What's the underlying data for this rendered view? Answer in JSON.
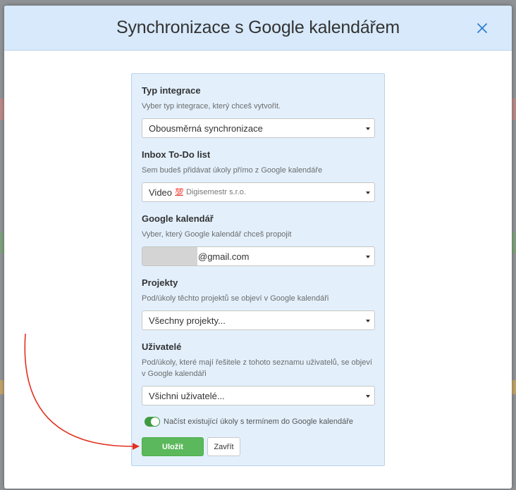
{
  "modal": {
    "title": "Synchronizace s Google kalendářem"
  },
  "form": {
    "integration_type": {
      "label": "Typ integrace",
      "help": "Vyber typ integrace, který chceš vytvořit.",
      "value": "Obousměrná synchronizace"
    },
    "inbox_todo": {
      "label": "Inbox To-Do list",
      "help": "Sem budeš přidávat úkoly přímo z Google kalendáře",
      "value": "Video",
      "emoji": "💯",
      "company": "Digisemestr s.r.o."
    },
    "google_calendar": {
      "label": "Google kalendář",
      "help": "Vyber, který Google kalendář chceš propojit",
      "value_suffix": "@gmail.com"
    },
    "projects": {
      "label": "Projekty",
      "help": "Pod/úkoly těchto projektů se objeví v Google kalendáři",
      "value": "Všechny projekty..."
    },
    "users": {
      "label": "Uživatelé",
      "help": "Pod/úkoly, které mají řešitele z tohoto seznamu uživatelů, se objeví v Google kalendáři",
      "value": "Všichni uživatelé..."
    },
    "load_existing": {
      "label": "Načíst existující úkoly s termínem do Google kalendáře",
      "checked": true
    },
    "buttons": {
      "save": "Uložit",
      "close": "Zavřít"
    }
  },
  "colors": {
    "header_bg": "#d7e9fa",
    "panel_bg": "#e3f0fc",
    "save_green": "#5cb85c",
    "close_icon": "#2f7fd1",
    "annotation_arrow": "#e2301f"
  },
  "icons": {
    "close": "close-icon",
    "caret": "caret-down-icon"
  }
}
